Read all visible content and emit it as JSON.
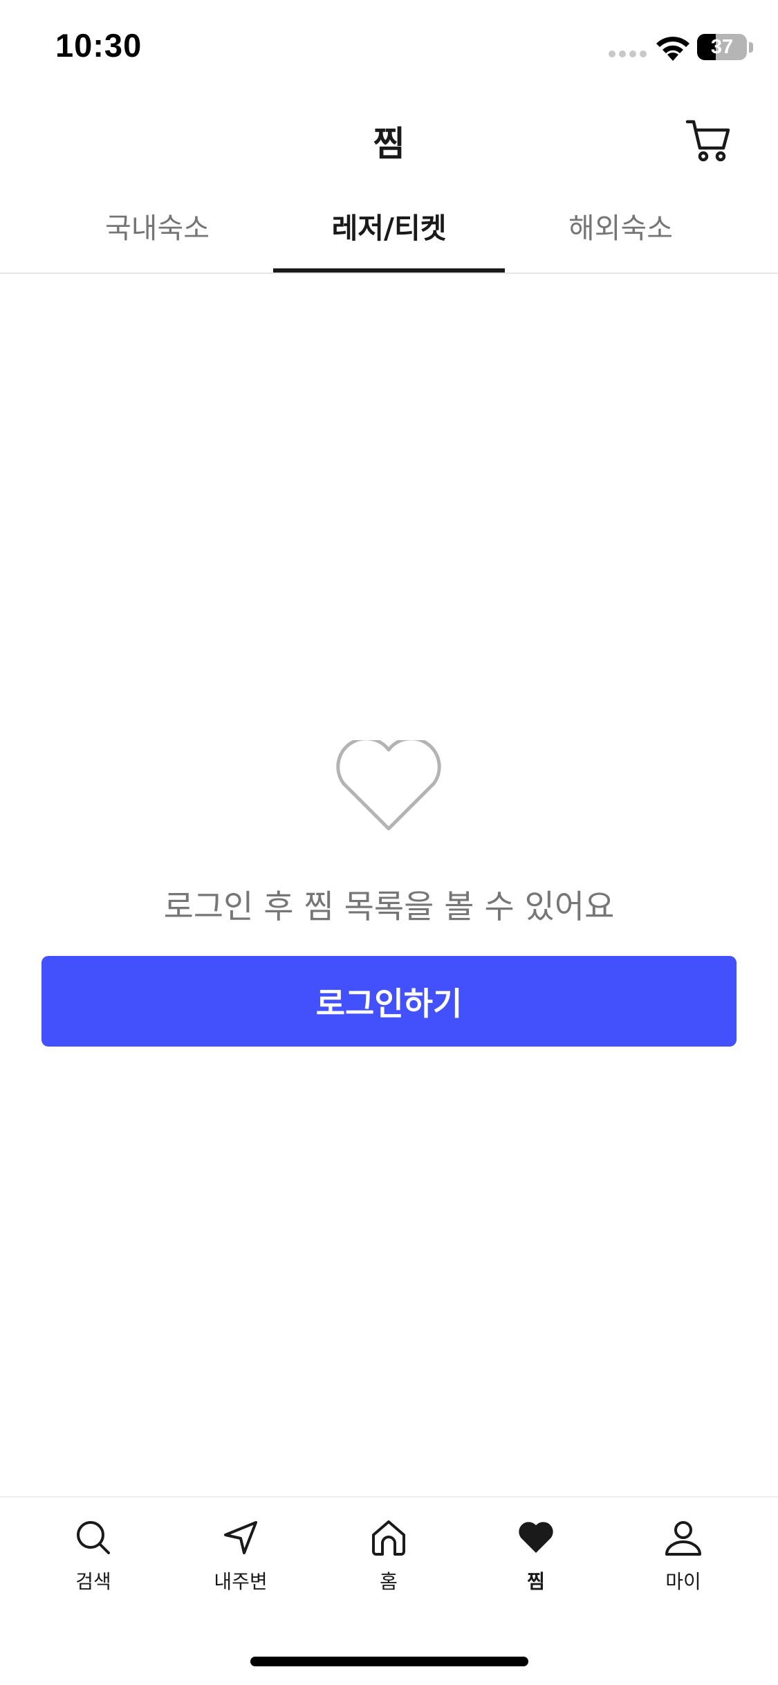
{
  "status_bar": {
    "time": "10:30",
    "battery_level": "37",
    "battery_fraction": 0.37
  },
  "header": {
    "title": "찜",
    "cart_icon": "cart-icon"
  },
  "tabs": [
    {
      "label": "국내숙소",
      "active": false
    },
    {
      "label": "레저/티켓",
      "active": true
    },
    {
      "label": "해외숙소",
      "active": false
    }
  ],
  "empty_state": {
    "icon": "heart-outline-icon",
    "message": "로그인 후 찜 목록을 볼 수 있어요",
    "login_button_label": "로그인하기"
  },
  "bottom_nav": [
    {
      "label": "검색",
      "icon": "search-icon",
      "active": false
    },
    {
      "label": "내주변",
      "icon": "navigation-arrow-icon",
      "active": false
    },
    {
      "label": "홈",
      "icon": "home-icon",
      "active": false
    },
    {
      "label": "찜",
      "icon": "heart-filled-icon",
      "active": true
    },
    {
      "label": "마이",
      "icon": "person-icon",
      "active": false
    }
  ],
  "colors": {
    "primary": "#4351fc",
    "text_primary": "#1a1a1a",
    "text_secondary": "#767676",
    "icon_muted": "#b3b3b3"
  }
}
